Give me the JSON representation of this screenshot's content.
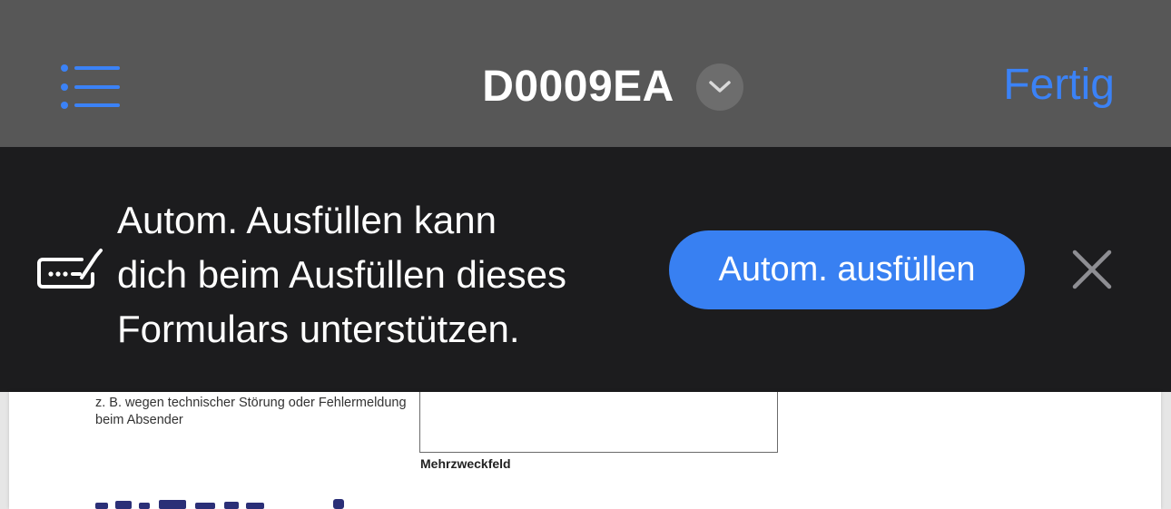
{
  "navbar": {
    "title": "D0009EA",
    "done_label": "Fertig",
    "list_icon": "list-icon",
    "chevron_icon": "chevron-down-icon",
    "accent_color": "#3b82f6"
  },
  "banner": {
    "message": "Autom. Ausfüllen kann\ndich beim Ausfüllen dieses\nFormulars unterstützen.",
    "button_label": "Autom. ausfüllen",
    "form_icon": "form-autofill-icon",
    "close_icon": "close-icon",
    "button_color": "#3880f2"
  },
  "document": {
    "note": "z. B. wegen technischer Störung oder Fehlermeldung\nbeim Absender",
    "field_label": "Mehrzweckfeld"
  }
}
